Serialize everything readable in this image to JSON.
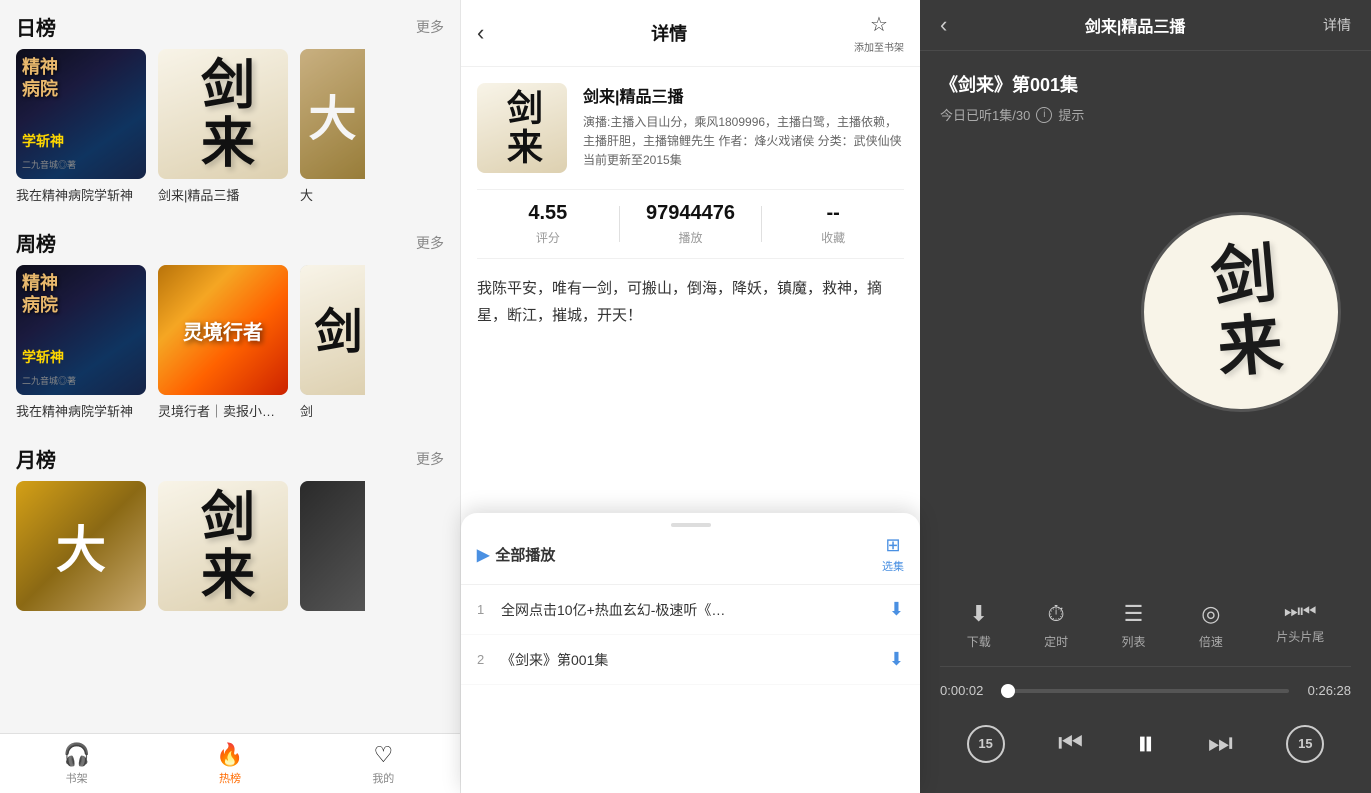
{
  "left": {
    "daily": {
      "section_title": "日榜",
      "more_label": "更多",
      "books": [
        {
          "id": "jingshen1",
          "title": "我在精神病院学斩神",
          "cover_type": "jingshen"
        },
        {
          "id": "jianlai1",
          "title": "剑来|精品三播",
          "cover_type": "jianlai"
        },
        {
          "id": "da1",
          "title": "大",
          "cover_type": "partial",
          "partial": true
        }
      ]
    },
    "weekly": {
      "section_title": "周榜",
      "more_label": "更多",
      "books": [
        {
          "id": "jingshen2",
          "title": "我在精神病院学斩神",
          "cover_type": "jingshen"
        },
        {
          "id": "lingboundary",
          "title": "灵境行者｜卖报小…",
          "cover_type": "lingboundary"
        },
        {
          "id": "jian2",
          "title": "剑",
          "cover_type": "partial",
          "partial": true
        }
      ]
    },
    "monthly": {
      "section_title": "月榜",
      "more_label": "更多",
      "books": [
        {
          "id": "da2",
          "title": "大",
          "cover_type": "da"
        },
        {
          "id": "jianlai3",
          "title": "剑来",
          "cover_type": "jianlai_partial"
        },
        {
          "id": "partial3",
          "title": "",
          "cover_type": "partial",
          "partial": true
        }
      ]
    },
    "nav": {
      "items": [
        {
          "id": "bookshelf",
          "label": "书架",
          "icon": "🎧",
          "active": false
        },
        {
          "id": "hot",
          "label": "热榜",
          "icon": "🔥",
          "active": true
        },
        {
          "id": "mine",
          "label": "我的",
          "icon": "❤️",
          "active": false
        }
      ]
    }
  },
  "middle": {
    "header": {
      "back_icon": "‹",
      "title": "详情",
      "bookmark_icon": "☆",
      "bookmark_label": "添加至书架"
    },
    "book": {
      "title": "剑来|精品三播",
      "description": "演播:主播入目山分，乘风1809996，主播白鹭，主播依赖，主播肝胆，主播锦鲤先生  作者：烽火戏诸侯 分类：武侠仙侠  当前更新至2015集",
      "rating": "4.55",
      "rating_label": "评分",
      "plays": "97944476",
      "plays_label": "播放",
      "favorites": "--",
      "favorites_label": "收藏",
      "synopsis": "我陈平安，唯有一剑，可搬山，倒海，降妖，镇魔，救神，摘星，断江，摧城，开天！"
    },
    "popup": {
      "play_all_label": "▶ 全部播放",
      "select_label": "选集",
      "episodes": [
        {
          "num": "1",
          "title": "全网点击10亿+热血玄幻-极速听《…",
          "has_download": true
        },
        {
          "num": "2",
          "title": "《剑来》第001集",
          "has_download": true
        }
      ]
    }
  },
  "right": {
    "header": {
      "back_icon": "‹",
      "title": "剑来|精品三播",
      "detail_label": "详情"
    },
    "episode": {
      "name": "《剑来》第001集",
      "progress_text": "今日已听1集/30",
      "info_icon": "ℹ",
      "hint_label": "提示"
    },
    "actions": [
      {
        "id": "download",
        "icon": "⬇",
        "label": "下载"
      },
      {
        "id": "timer",
        "icon": "⏱",
        "label": "定时"
      },
      {
        "id": "playlist",
        "icon": "≡♪",
        "label": "列表"
      },
      {
        "id": "speed",
        "icon": "⊙",
        "label": "倍速"
      },
      {
        "id": "skip",
        "icon": "⏭⏮",
        "label": "片头片尾"
      }
    ],
    "progress": {
      "current": "0:00:02",
      "total": "0:26:28",
      "fill_percent": 2
    },
    "controls": {
      "rewind_label": "⑮",
      "prev_label": "⏮",
      "play_pause_label": "⏸",
      "next_label": "⏭",
      "forward_label": "⑮"
    }
  }
}
